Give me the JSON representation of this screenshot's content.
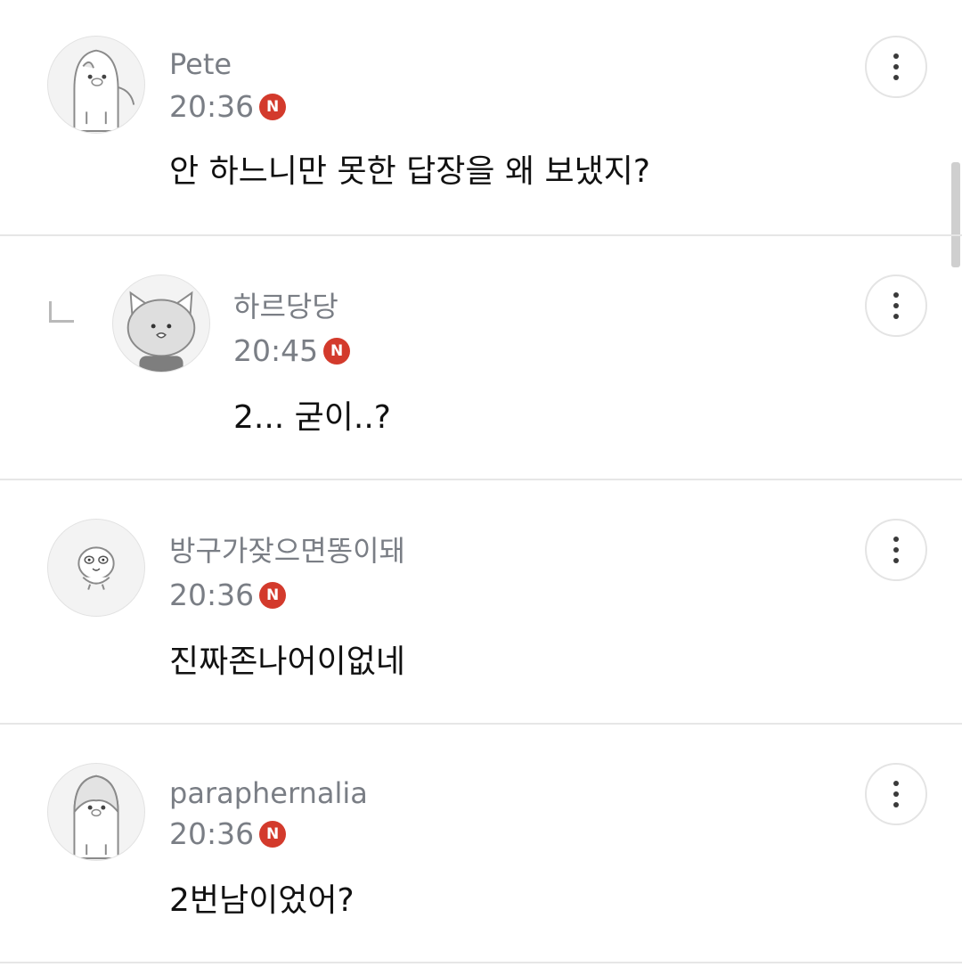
{
  "colors": {
    "badge": "#d33a2c",
    "meta_text": "#7a7e85",
    "body_text": "#111111",
    "divider": "#e6e6e6"
  },
  "comments": [
    {
      "nickname": "Pete",
      "time": "20:36",
      "badge": "N",
      "text": "안 하느니만 못한 답장을 왜 보냈지?",
      "avatar_icon": "penguin-avatar-icon",
      "is_reply": false
    },
    {
      "nickname": "하르당당",
      "time": "20:45",
      "badge": "N",
      "text": "2... 굳이..?",
      "avatar_icon": "cat-avatar-icon",
      "is_reply": true
    },
    {
      "nickname": "방구가잦으면똥이돼",
      "time": "20:36",
      "badge": "N",
      "text": "진짜존나어이없네",
      "avatar_icon": "chick-avatar-icon",
      "is_reply": false
    },
    {
      "nickname": "paraphernalia",
      "time": "20:36",
      "badge": "N",
      "text": "2번남이었어?",
      "avatar_icon": "penguin-avatar-icon",
      "is_reply": false
    }
  ],
  "more_button_icon": "more-vertical-icon",
  "reply_indicator_icon": "reply-arrow-icon"
}
